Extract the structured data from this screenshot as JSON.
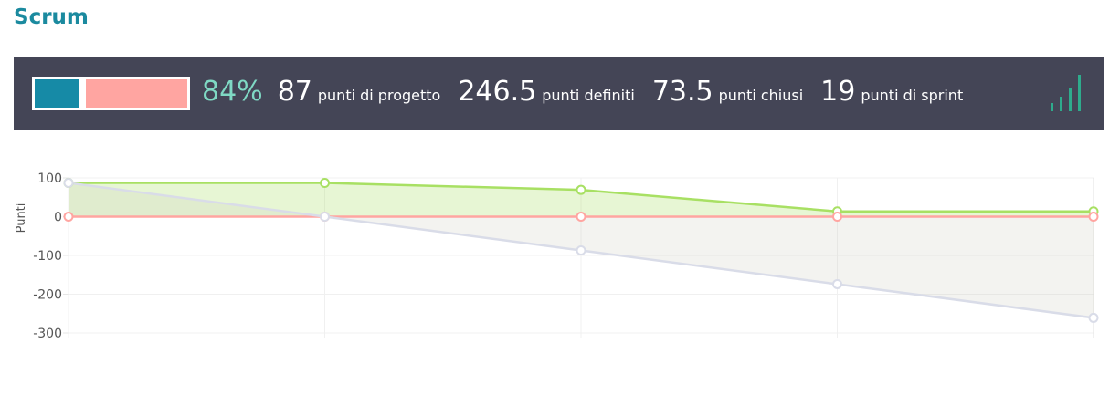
{
  "page": {
    "title": "Scrum"
  },
  "stats": {
    "percent": "84%",
    "progress_fraction": 0.84,
    "items": [
      {
        "value": "87",
        "label": "punti di progetto"
      },
      {
        "value": "246.5",
        "label": "punti definiti"
      },
      {
        "value": "73.5",
        "label": "punti chiusi"
      },
      {
        "value": "19",
        "label": "punti di sprint"
      }
    ],
    "icon": "signal-bars-icon"
  },
  "colors": {
    "title": "#1b8a9f",
    "bar_background": "#444556",
    "progress_done": "#168aa6",
    "progress_rest": "#ffa5a1",
    "percent_text": "#7fd9c4",
    "icon": "#2eab8c"
  },
  "chart_data": {
    "type": "line",
    "ylabel": "Punti",
    "ylim": [
      -300,
      100
    ],
    "yticks": [
      100,
      0,
      -100,
      -200,
      -300
    ],
    "x": [
      0,
      1,
      2,
      3,
      4
    ],
    "grid": true,
    "series": [
      {
        "color": "#a8e063",
        "fill": "rgba(168,224,99,0.28)",
        "values": [
          87,
          87,
          69,
          13.5,
          13.5
        ]
      },
      {
        "color": "#ffa5a1",
        "fill": "rgba(255,165,161,0.15)",
        "values": [
          0,
          0,
          0,
          0,
          0
        ]
      },
      {
        "color": "#d9dce8",
        "fill": "rgba(200,200,185,0.22)",
        "values": [
          87,
          0,
          -87,
          -174,
          -261
        ]
      }
    ]
  }
}
